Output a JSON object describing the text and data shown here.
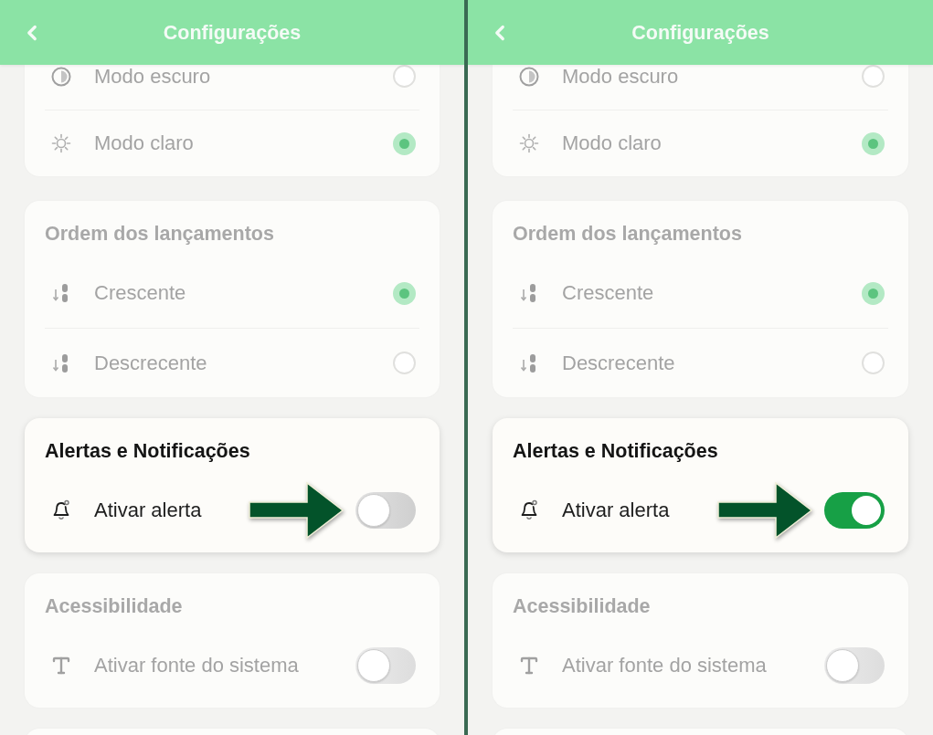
{
  "panels": [
    {
      "header": {
        "title": "Configurações"
      },
      "sections": [
        {
          "focused": false,
          "items": [
            {
              "kind": "radio",
              "label": "Modo escuro",
              "selected": false
            },
            {
              "kind": "radio",
              "label": "Modo claro",
              "selected": true
            }
          ]
        },
        {
          "title": "Ordem dos lançamentos",
          "focused": false,
          "items": [
            {
              "kind": "radio",
              "label": "Crescente",
              "selected": true
            },
            {
              "kind": "radio",
              "label": "Descrecente",
              "selected": false
            }
          ]
        },
        {
          "title": "Alertas e Notificações",
          "focused": true,
          "items": [
            {
              "kind": "toggle",
              "label": "Ativar alerta",
              "on": false
            }
          ]
        },
        {
          "title": "Acessibilidade",
          "focused": false,
          "items": [
            {
              "kind": "toggle",
              "label": "Ativar fonte do sistema",
              "on": false
            }
          ]
        }
      ]
    },
    {
      "header": {
        "title": "Configurações"
      },
      "sections": [
        {
          "focused": false,
          "items": [
            {
              "kind": "radio",
              "label": "Modo escuro",
              "selected": false
            },
            {
              "kind": "radio",
              "label": "Modo claro",
              "selected": true
            }
          ]
        },
        {
          "title": "Ordem dos lançamentos",
          "focused": false,
          "items": [
            {
              "kind": "radio",
              "label": "Crescente",
              "selected": true
            },
            {
              "kind": "radio",
              "label": "Descrecente",
              "selected": false
            }
          ]
        },
        {
          "title": "Alertas e Notificações",
          "focused": true,
          "items": [
            {
              "kind": "toggle",
              "label": "Ativar alerta",
              "on": true
            }
          ]
        },
        {
          "title": "Acessibilidade",
          "focused": false,
          "items": [
            {
              "kind": "toggle",
              "label": "Ativar fonte do sistema",
              "on": false
            }
          ]
        }
      ]
    }
  ]
}
